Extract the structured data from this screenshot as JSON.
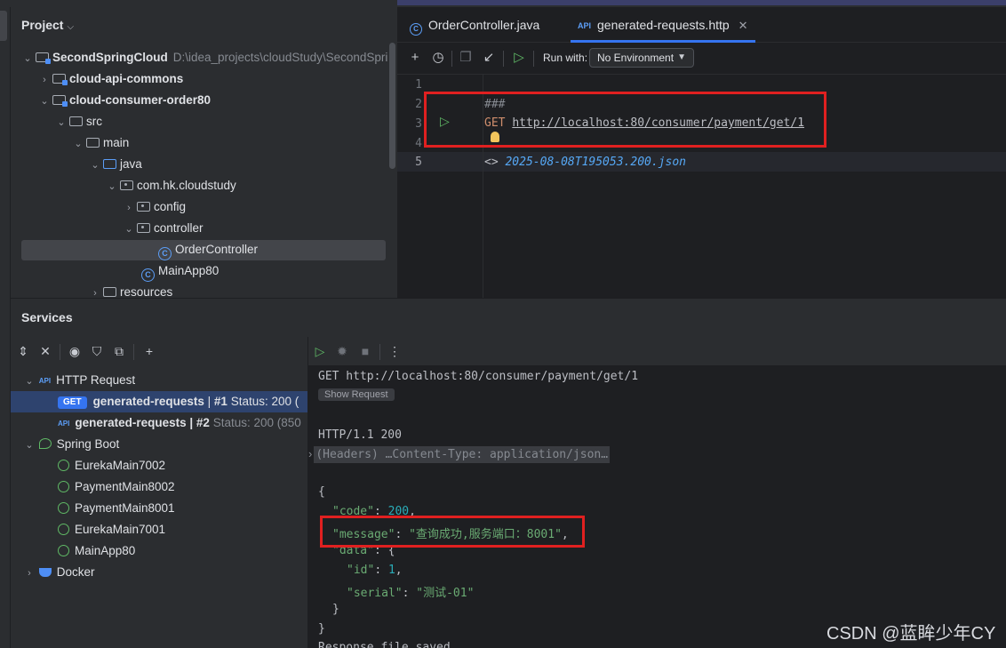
{
  "project": {
    "title": "Project",
    "tree": [
      {
        "label": "SecondSpringCloud",
        "path": "D:\\idea_projects\\cloudStudy\\SecondSpri",
        "bold": true
      },
      {
        "label": "cloud-api-commons"
      },
      {
        "label": "cloud-consumer-order80"
      },
      {
        "label": "src"
      },
      {
        "label": "main"
      },
      {
        "label": "java"
      },
      {
        "label": "com.hk.cloudstudy"
      },
      {
        "label": "config"
      },
      {
        "label": "controller"
      },
      {
        "label": "OrderController"
      },
      {
        "label": "MainApp80"
      },
      {
        "label": "resources"
      }
    ]
  },
  "editor": {
    "tabs": [
      {
        "label": "OrderController.java",
        "icon": "class-icon"
      },
      {
        "label": "generated-requests.http",
        "icon": "http-api-icon",
        "active": true
      }
    ],
    "toolbar": {
      "run_with_label": "Run with:",
      "environment": "No Environment"
    },
    "line_numbers": [
      "1",
      "2",
      "3",
      "4",
      "5"
    ],
    "lines": {
      "l2": "###",
      "l3_method": "GET",
      "l3_url": "http://localhost:80/consumer/payment/get/1",
      "l5_arrow": "<>",
      "l5_file": "2025-08-08T195053.200.json"
    }
  },
  "services": {
    "title": "Services",
    "tree": {
      "http_request": "HTTP Request",
      "req1_badge": "GET",
      "req1_name": "generated-requests",
      "req1_sep": "|",
      "req1_num": "#1",
      "req1_status": "Status: 200 (",
      "req2_name": "generated-requests | #2",
      "req2_status": "Status: 200 (850",
      "spring_boot": "Spring Boot",
      "apps": [
        "EurekaMain7002",
        "PaymentMain8002",
        "PaymentMain8001",
        "EurekaMain7001",
        "MainApp80"
      ],
      "docker": "Docker"
    },
    "response": {
      "request_line": "GET http://localhost:80/consumer/payment/get/1",
      "show_request": "Show Request",
      "status_line": "HTTP/1.1 200",
      "headers_fold": "(Headers) …Content-Type: application/json…",
      "open_brace": "{",
      "code_key": "\"code\"",
      "code_val": "200",
      "message_key": "\"message\"",
      "message_val": "\"查询成功,服务端口：8001\"",
      "data_key": "\"data\"",
      "id_key": "\"id\"",
      "id_val": "1",
      "serial_key": "\"serial\"",
      "serial_val": "\"测试-01\"",
      "inner_close": "}",
      "outer_close": "}",
      "footer": "Response file saved."
    }
  },
  "watermark": "CSDN @蓝眸少年CY",
  "colors": {
    "accent": "#3574f0",
    "highlight_box": "#e02020",
    "json_string": "#6aab73",
    "json_number": "#2aacb8"
  }
}
